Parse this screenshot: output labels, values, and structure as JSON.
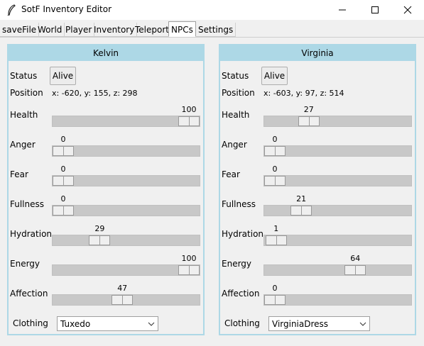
{
  "window": {
    "title": "SotF Inventory Editor",
    "icon": "feather-icon"
  },
  "tabs": [
    {
      "label": "saveFile"
    },
    {
      "label": "World"
    },
    {
      "label": "Player"
    },
    {
      "label": "Inventory"
    },
    {
      "label": "Teleport"
    },
    {
      "label": "NPCs",
      "active": true
    },
    {
      "label": "Settings"
    }
  ],
  "labels": {
    "status": "Status",
    "position": "Position",
    "clothing": "Clothing"
  },
  "slider_range": [
    0,
    100
  ],
  "npcs": [
    {
      "name": "Kelvin",
      "status": "Alive",
      "position": "x: -620, y: 155, z: 298",
      "stats": [
        {
          "label": "Health",
          "value": 100
        },
        {
          "label": "Anger",
          "value": 0
        },
        {
          "label": "Fear",
          "value": 0
        },
        {
          "label": "Fullness",
          "value": 0
        },
        {
          "label": "Hydration",
          "value": 29
        },
        {
          "label": "Energy",
          "value": 100
        },
        {
          "label": "Affection",
          "value": 47
        }
      ],
      "clothing": "Tuxedo"
    },
    {
      "name": "Virginia",
      "status": "Alive",
      "position": "x: -603, y: 97, z: 514",
      "stats": [
        {
          "label": "Health",
          "value": 27
        },
        {
          "label": "Anger",
          "value": 0
        },
        {
          "label": "Fear",
          "value": 0
        },
        {
          "label": "Fullness",
          "value": 21
        },
        {
          "label": "Hydration",
          "value": 1
        },
        {
          "label": "Energy",
          "value": 64
        },
        {
          "label": "Affection",
          "value": 0
        }
      ],
      "clothing": "VirginiaDress"
    }
  ],
  "colors": {
    "panel_border": "#add8e6",
    "panel_header": "#add8e6",
    "trough": "#c8c8c8",
    "background": "#f0f0f0"
  }
}
